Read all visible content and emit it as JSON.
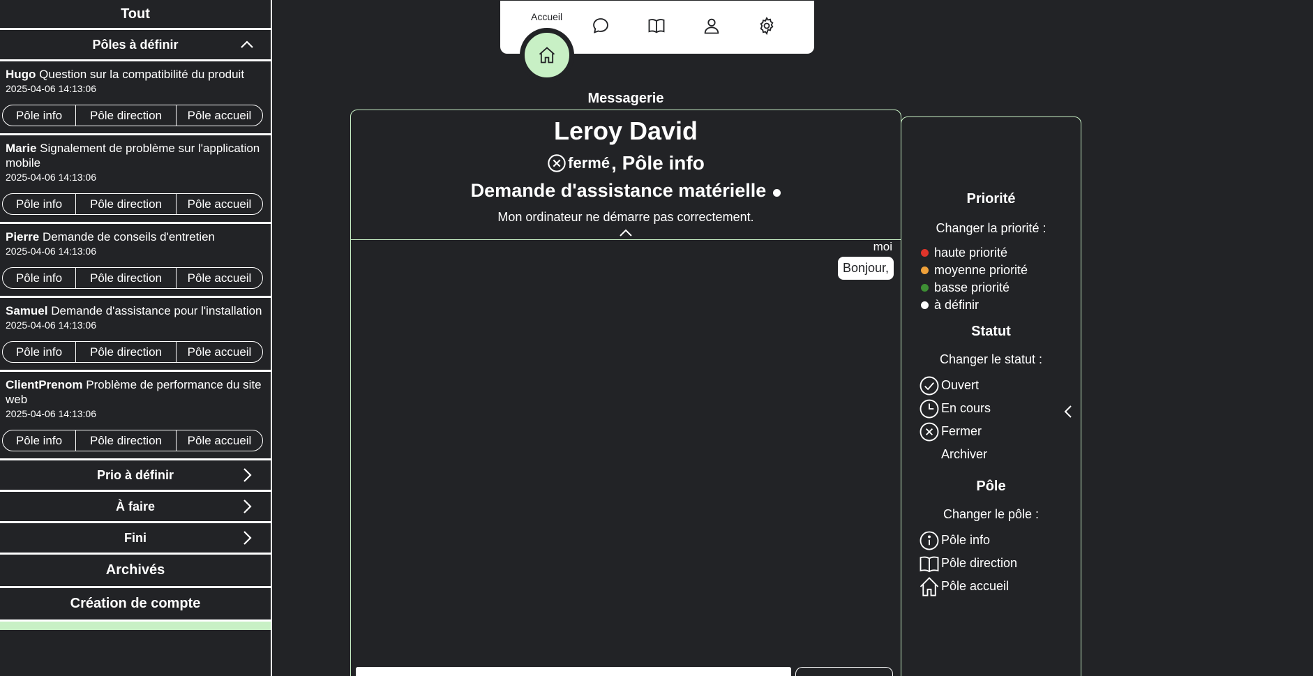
{
  "sidebar": {
    "all_label": "Tout",
    "group_poles": {
      "label": "Pôles à définir"
    },
    "tickets": [
      {
        "name": "Hugo",
        "subject": "Question sur la compatibilité du produit",
        "date": "2025-04-06 14:13:06",
        "poles": [
          "Pôle info",
          "Pôle direction",
          "Pôle accueil"
        ]
      },
      {
        "name": "Marie",
        "subject": "Signalement de problème sur l'application mobile",
        "date": "2025-04-06 14:13:06",
        "poles": [
          "Pôle info",
          "Pôle direction",
          "Pôle accueil"
        ]
      },
      {
        "name": "Pierre",
        "subject": "Demande de conseils d'entretien",
        "date": "2025-04-06 14:13:06",
        "poles": [
          "Pôle info",
          "Pôle direction",
          "Pôle accueil"
        ]
      },
      {
        "name": "Samuel",
        "subject": "Demande d'assistance pour l'installation",
        "date": "2025-04-06 14:13:06",
        "poles": [
          "Pôle info",
          "Pôle direction",
          "Pôle accueil"
        ]
      },
      {
        "name": "ClientPrenom",
        "subject": "Problème de performance du site web",
        "date": "2025-04-06 14:13:06",
        "poles": [
          "Pôle info",
          "Pôle direction",
          "Pôle accueil"
        ]
      }
    ],
    "groups": [
      {
        "label": "Prio à définir"
      },
      {
        "label": "À faire"
      },
      {
        "label": "Fini"
      }
    ],
    "archived_label": "Archivés",
    "create_account_label": "Création de compte"
  },
  "nav": {
    "home_label": "Accueil",
    "icons": [
      "home-icon",
      "chat-icon",
      "book-icon",
      "user-icon",
      "settings-icon"
    ]
  },
  "main": {
    "title": "Messagerie",
    "client_name": "Leroy David",
    "status": "fermé",
    "pole": ", Pôle info",
    "subject": "Demande d'assistance matérielle",
    "description": "Mon ordinateur ne démarre pas correctement.",
    "messages": [
      {
        "author": "moi",
        "text": "Bonjour,"
      }
    ]
  },
  "right_panel": {
    "priority": {
      "title": "Priorité",
      "change_label": "Changer la priorité :",
      "options": [
        {
          "label": "haute priorité",
          "color": "#e0352b"
        },
        {
          "label": "moyenne priorité",
          "color": "#f0a13a"
        },
        {
          "label": "basse priorité",
          "color": "#3e8f34"
        },
        {
          "label": "à définir",
          "color": "#ffffff"
        }
      ]
    },
    "status": {
      "title": "Statut",
      "change_label": "Changer le statut :",
      "options": [
        {
          "label": "Ouvert",
          "icon": "check-circle-icon"
        },
        {
          "label": "En cours",
          "icon": "clock-icon"
        },
        {
          "label": "Fermer",
          "icon": "x-circle-icon"
        },
        {
          "label": "Archiver",
          "icon": ""
        }
      ]
    },
    "pole": {
      "title": "Pôle",
      "change_label": "Changer le pôle :",
      "options": [
        {
          "label": "Pôle info",
          "icon": "info-icon"
        },
        {
          "label": "Pôle direction",
          "icon": "book-icon"
        },
        {
          "label": "Pôle accueil",
          "icon": "home-icon"
        }
      ]
    }
  },
  "colors": {
    "background": "#222326",
    "accent_green": "#c8f0c5",
    "text": "#ffffff"
  }
}
